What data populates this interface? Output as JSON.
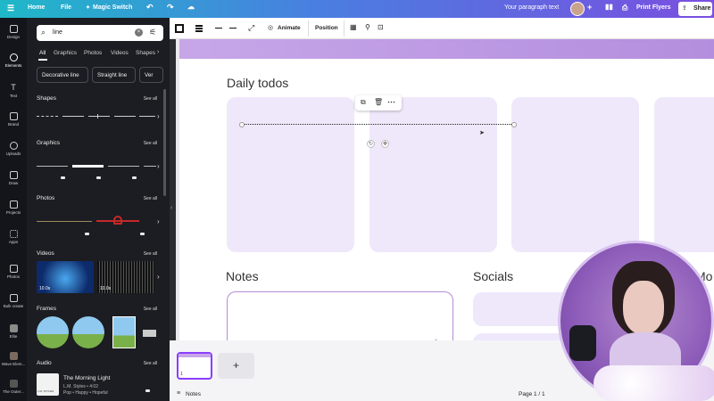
{
  "topbar": {
    "home": "Home",
    "file": "File",
    "magic_switch": "Magic Switch",
    "doc_title": "Your paragraph text",
    "print": "Print Flyers",
    "share": "Share"
  },
  "rail": {
    "items": [
      "Design",
      "Elements",
      "Text",
      "Brand",
      "Uploads",
      "Draw",
      "Projects",
      "Apps",
      "Photos",
      "Bulk create",
      "Elite",
      "Wave Elem...",
      "The Outer..."
    ]
  },
  "panel": {
    "search_value": "line",
    "tabs": [
      "All",
      "Graphics",
      "Photos",
      "Videos",
      "Shapes"
    ],
    "chips": [
      "Decorative line",
      "Straight line",
      "Ver"
    ],
    "sections": {
      "shapes": "Shapes",
      "graphics": "Graphics",
      "photos": "Photos",
      "videos": "Videos",
      "frames": "Frames",
      "audio": "Audio"
    },
    "see_all": "See all",
    "video_durations": [
      "10.0s",
      "10.0s"
    ],
    "audio": {
      "title": "The Morning Light",
      "artist": "L.M. Styles • 4:02",
      "tags": "Pop • Happy • Hopeful",
      "thumb_text": "L.M. STYLES"
    }
  },
  "toolbar": {
    "animate": "Animate",
    "position": "Position"
  },
  "canvas": {
    "heading_todos": "Daily todos",
    "heading_notes": "Notes",
    "heading_socials": "Socials",
    "heading_partial": "Mo"
  },
  "bottom": {
    "notes": "Notes",
    "page_indicator": "Page 1 / 1",
    "thumb_num": "1"
  },
  "colors": {
    "topbar_start": "#1fb8c8",
    "topbar_end": "#7a4fe0",
    "card_fill": "#efe8fb",
    "banner": "#c7a6e8",
    "notes_border": "#b58bd9"
  }
}
